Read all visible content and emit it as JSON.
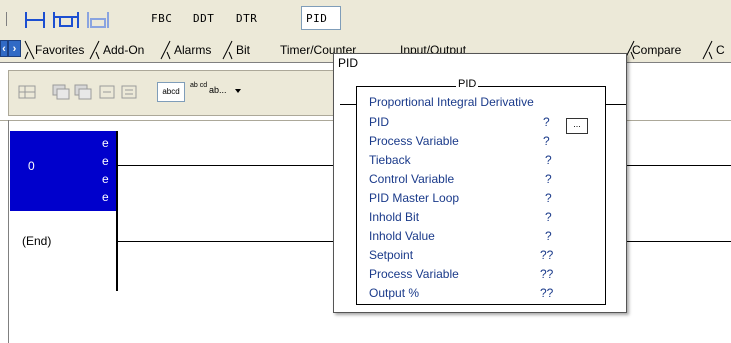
{
  "toolbar": {
    "fbc_label": "FBC",
    "ddt_label": "DDT",
    "dtr_label": "DTR",
    "pid_label": "PID"
  },
  "tabs": {
    "items": [
      "Favorites",
      "Add-On",
      "Alarms",
      "Bit",
      "Timer/Counter",
      "Input/Output",
      "Compare",
      "C"
    ]
  },
  "palette": {
    "text_box_1": "abcd",
    "text_box_2": "ab cd",
    "dropdown_label": "ab..."
  },
  "ladder": {
    "rung_number": "0",
    "rung_marker": "e",
    "end_label": "(End)"
  },
  "pid_window": {
    "title": "PID",
    "block_name": "PID",
    "description": "Proportional Integral Derivative",
    "ellipsis": "...",
    "parameters": [
      {
        "label": "PID",
        "value": "?"
      },
      {
        "label": "Process Variable",
        "value": "?"
      },
      {
        "label": "Tieback",
        "value": "?"
      },
      {
        "label": "Control Variable",
        "value": "?"
      },
      {
        "label": "PID Master Loop",
        "value": "?"
      },
      {
        "label": "Inhold Bit",
        "value": "?"
      },
      {
        "label": "Inhold Value",
        "value": "?"
      },
      {
        "label": "Setpoint",
        "value": "??"
      },
      {
        "label": "Process Variable",
        "value": "??"
      },
      {
        "label": "Output %",
        "value": "??"
      }
    ]
  }
}
